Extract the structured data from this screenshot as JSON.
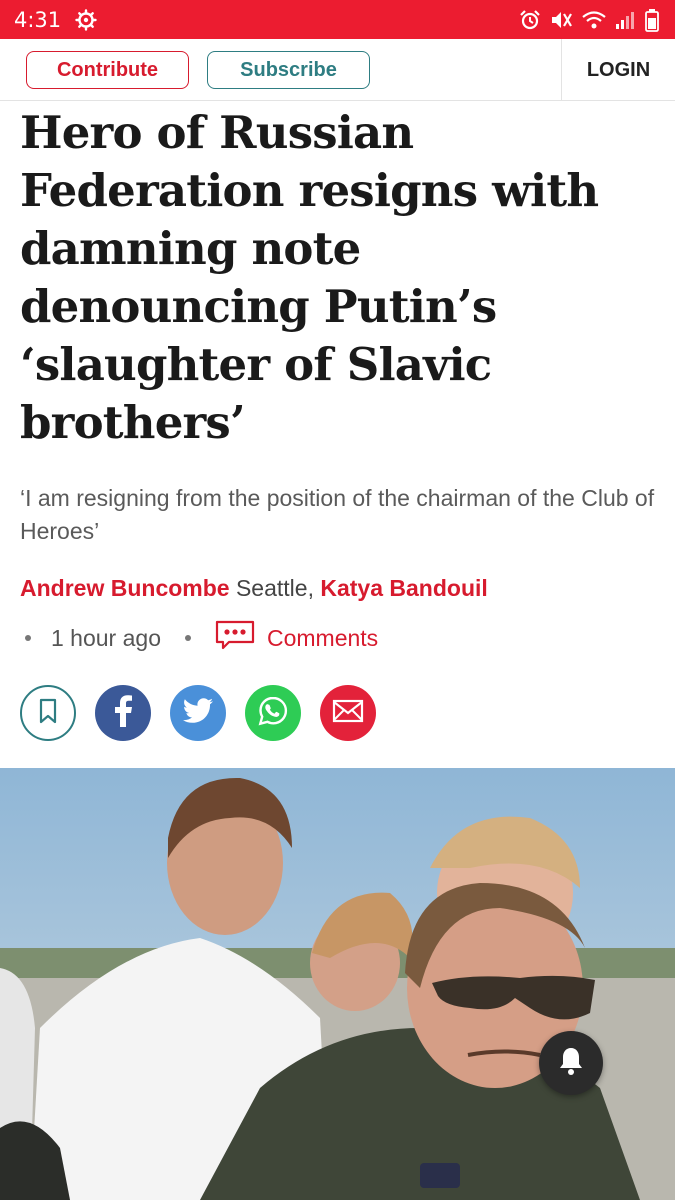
{
  "status_bar": {
    "time": "4:31",
    "background": "#ec1c30",
    "icons": [
      "settings-icon",
      "alarm-icon",
      "mute-icon",
      "wifi-icon",
      "signal-icon",
      "battery-icon"
    ]
  },
  "header": {
    "contribute_label": "Contribute",
    "subscribe_label": "Subscribe",
    "login_label": "LOGIN",
    "contribute_color": "#d71b2e",
    "subscribe_color": "#2e7d82"
  },
  "article": {
    "headline_lines": [
      "Hero of Russian",
      "Federation resigns with",
      "damning note",
      "denouncing Putin’s",
      "‘slaughter of Slavic",
      "brothers’"
    ],
    "standfirst": "‘I am resigning from the position of the chairman of the Club of Heroes’",
    "byline": {
      "author1": "Andrew Buncombe",
      "location1": " Seattle, ",
      "author2": "Katya Bandouil"
    },
    "time_ago": "1 hour ago",
    "comments_label": "Comments"
  },
  "share": {
    "buttons": [
      "bookmark-icon",
      "facebook-icon",
      "twitter-icon",
      "whatsapp-icon",
      "email-icon"
    ]
  },
  "photo": {
    "icon": "notification-bell-icon"
  }
}
